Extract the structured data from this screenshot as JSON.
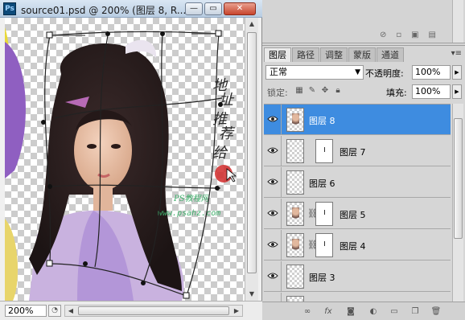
{
  "document": {
    "app_icon": "Ps",
    "title": "source01.psd @ 200% (图层 8, R...",
    "window_buttons": {
      "minimize": "—",
      "restore": "▭",
      "close": "✕"
    },
    "zoom": "200%",
    "watermark": {
      "right_text": "地址 推荐 给你",
      "url": "www.psahz.com",
      "bottom_text": "PS教程网"
    }
  },
  "layers_panel": {
    "tabs": [
      {
        "label": "图层",
        "active": true
      },
      {
        "label": "路径",
        "active": false
      },
      {
        "label": "调整",
        "active": false
      },
      {
        "label": "蒙版",
        "active": false
      },
      {
        "label": "通道",
        "active": false
      }
    ],
    "blend_mode": "正常",
    "opacity_label": "不透明度:",
    "opacity_value": "100%",
    "lock_label": "锁定:",
    "fill_label": "填充:",
    "fill_value": "100%",
    "layers": [
      {
        "name": "图层 8",
        "selected": true,
        "thumb": "girl",
        "mask": false
      },
      {
        "name": "图层 7",
        "selected": false,
        "thumb": "empty",
        "mask": true
      },
      {
        "name": "图层 6",
        "selected": false,
        "thumb": "empty",
        "mask": false
      },
      {
        "name": "图层 5",
        "selected": false,
        "thumb": "girl",
        "mask": true
      },
      {
        "name": "图层 4",
        "selected": false,
        "thumb": "girl",
        "mask": true
      },
      {
        "name": "图层 3",
        "selected": false,
        "thumb": "empty",
        "mask": false
      }
    ],
    "footer_icons": [
      "link-icon",
      "fx-icon",
      "add-mask-icon",
      "adjustment-icon",
      "folder-icon",
      "new-layer-icon",
      "trash-icon"
    ]
  },
  "colors": {
    "selection": "#3e8ce0",
    "panel_bg": "#d6d6d6",
    "title_bar": "#c4d6ea",
    "watermark_red": "#d12a2a"
  }
}
